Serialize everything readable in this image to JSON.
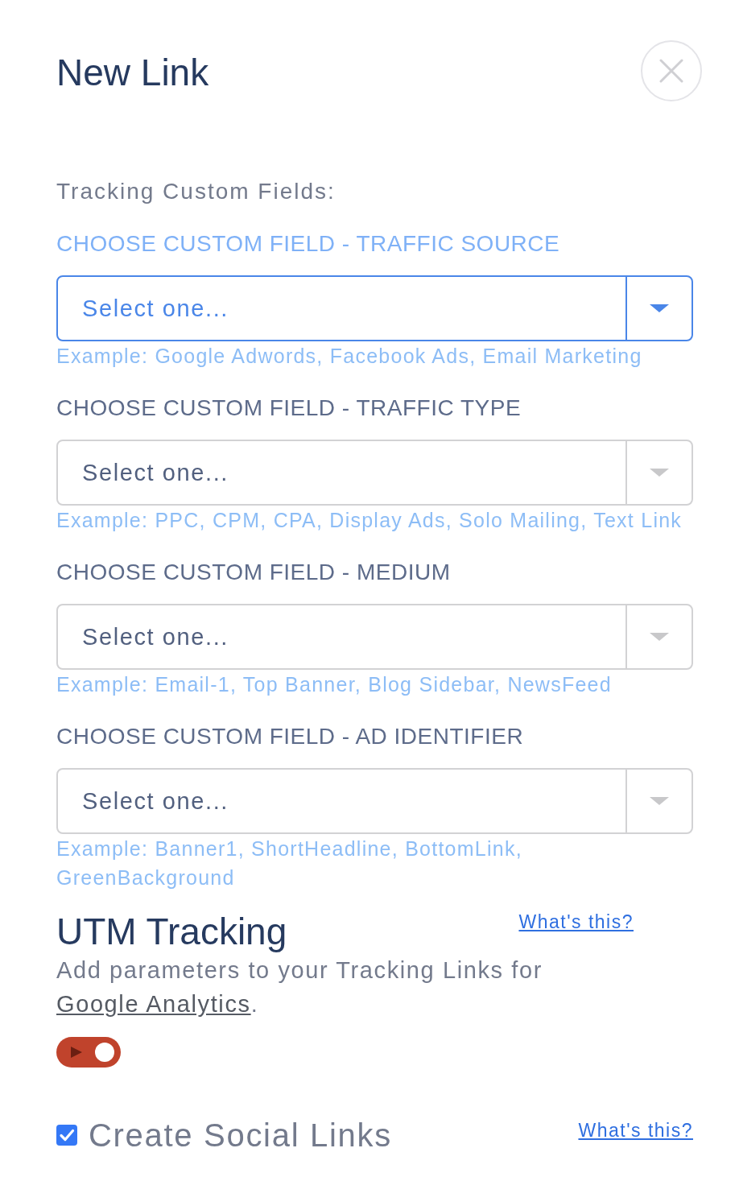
{
  "dialog": {
    "title": "New Link"
  },
  "custom_fields": {
    "heading": "Tracking Custom Fields:",
    "fields": [
      {
        "label": "CHOOSE CUSTOM FIELD - TRAFFIC SOURCE",
        "placeholder": "Select one...",
        "focused": true,
        "hint": "Example: Google Adwords, Facebook Ads, Email Marketing"
      },
      {
        "label": "CHOOSE CUSTOM FIELD - TRAFFIC TYPE",
        "placeholder": "Select one...",
        "focused": false,
        "hint": "Example: PPC, CPM, CPA, Display Ads, Solo Mailing, Text Link"
      },
      {
        "label": "CHOOSE CUSTOM FIELD - MEDIUM",
        "placeholder": "Select one...",
        "focused": false,
        "hint": "Example: Email-1, Top Banner, Blog Sidebar, NewsFeed"
      },
      {
        "label": "CHOOSE CUSTOM FIELD - AD IDENTIFIER",
        "placeholder": "Select one...",
        "focused": false,
        "hint": "Example: Banner1, ShortHeadline, BottomLink, GreenBackground"
      }
    ]
  },
  "utm_tracking": {
    "title": "UTM Tracking",
    "help_link": "What's this?",
    "description": {
      "text": "Add parameters to your Tracking Links for",
      "link": "Google Analytics",
      "after": "."
    },
    "toggle": {
      "on": true
    }
  },
  "social_links": {
    "label": "Create Social Links",
    "checked": true,
    "help_link": "What's this?"
  }
}
